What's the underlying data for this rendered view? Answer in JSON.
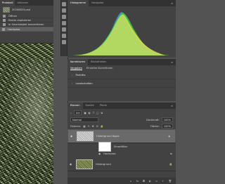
{
  "history": {
    "tabs": [
      "Protokoll",
      "Aktionen"
    ],
    "document": "20200823.psd",
    "items": [
      "Öffnen",
      "Ebene duplizieren",
      "In Smartobjekt konvertieren",
      "Hochpass"
    ]
  },
  "histogram": {
    "tabs": [
      "Histogramm",
      "Navigator"
    ]
  },
  "adjustments": {
    "tabs": [
      "Korrekturen",
      "Bibliotheken"
    ],
    "sub_tabs": [
      "Vorgaben",
      "Einzelne Korrekturen"
    ],
    "groups": [
      "Porträts",
      "Landschaften"
    ]
  },
  "layers": {
    "tabs": [
      "Ebenen",
      "Kanäle",
      "Pfade"
    ],
    "filter_label": "Art",
    "blend_mode": "Normal",
    "opacity_label": "Deckkraft:",
    "opacity_value": "100%",
    "lock_label": "Fixieren:",
    "fill_label": "Fläche:",
    "fill_value": "100%",
    "rows": [
      {
        "name": "Hintergrund Kopie",
        "selected": true
      },
      {
        "name": "Smartfilter",
        "sub": true
      },
      {
        "name": "Hochpass",
        "sub": true
      },
      {
        "name": "Hintergrund",
        "selected": false
      }
    ]
  },
  "colors": {
    "hist_yellow": "#e8e04a",
    "hist_green": "#4bcf4b",
    "hist_blue": "#3d9bd6"
  }
}
